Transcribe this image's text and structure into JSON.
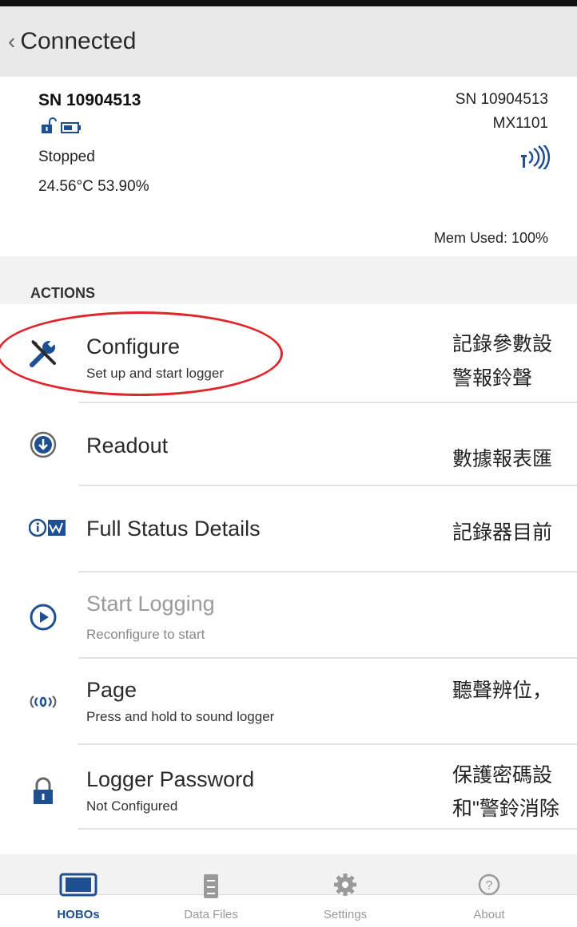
{
  "header": {
    "title": "Connected"
  },
  "device": {
    "serial_bold": "SN 10904513",
    "state": "Stopped",
    "reading": "24.56°C  53.90%",
    "serial_right": "SN 10904513",
    "model": "MX1101",
    "memory": "Mem Used: 100%"
  },
  "actions": {
    "label": "ACTIONS",
    "items": [
      {
        "title": "Configure",
        "subtitle": "Set up and start logger",
        "icon": "wrench-screwdriver-icon",
        "enabled": true,
        "note": "記錄參數設",
        "note2": "警報鈴聲"
      },
      {
        "title": "Readout",
        "subtitle": "",
        "icon": "download-circle-icon",
        "enabled": true,
        "note": "數據報表匯"
      },
      {
        "title": "Full Status Details",
        "subtitle": "",
        "icon": "info-status-icon",
        "enabled": true,
        "note": "記錄器目前"
      },
      {
        "title": "Start Logging",
        "subtitle": "Reconfigure to start",
        "icon": "play-circle-icon",
        "enabled": false,
        "note": ""
      },
      {
        "title": "Page",
        "subtitle": "Press and hold to sound logger",
        "icon": "sound-wave-icon",
        "enabled": true,
        "note": "聽聲辨位，"
      },
      {
        "title": "Logger Password",
        "subtitle": "Not Configured",
        "icon": "padlock-icon",
        "enabled": true,
        "note": "保護密碼設",
        "note2": "和\"警鈴消除"
      }
    ]
  },
  "bottom_nav": {
    "tabs": [
      {
        "label": "HOBOs",
        "icon": "logger-device-icon",
        "active": true
      },
      {
        "label": "Data Files",
        "icon": "file-cabinet-icon",
        "active": false
      },
      {
        "label": "Settings",
        "icon": "gear-icon",
        "active": false
      },
      {
        "label": "About",
        "icon": "question-circle-icon",
        "active": false
      }
    ]
  },
  "colors": {
    "accent": "#1d4f91",
    "annotation": "#e0262b",
    "disabled": "#9a9a9a"
  }
}
